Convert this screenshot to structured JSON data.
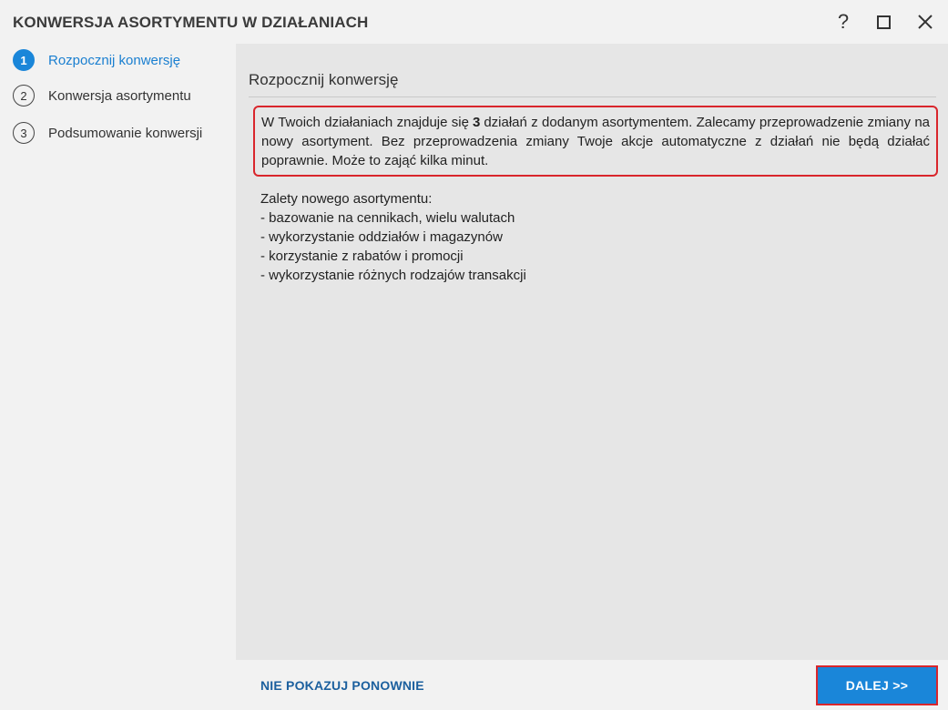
{
  "window": {
    "title": "KONWERSJA ASORTYMENTU W DZIAŁANIACH",
    "help_label": "?"
  },
  "steps": [
    {
      "number": "1",
      "label": "Rozpocznij konwersję",
      "active": true
    },
    {
      "number": "2",
      "label": "Konwersja asortymentu",
      "active": false
    },
    {
      "number": "3",
      "label": "Podsumowanie konwersji",
      "active": false
    }
  ],
  "main": {
    "section_title": "Rozpocznij konwersję",
    "notice": {
      "before": "W Twoich działaniach znajduje się",
      "count": "3",
      "after": "działań z dodanym asortymentem. Zalecamy przeprowadzenie zmiany na nowy asortyment. Bez przeprowadzenia zmiany Twoje akcje automatyczne z działań nie będą działać poprawnie. Może to zająć kilka minut."
    },
    "benefits_title": "Zalety nowego asortymentu:",
    "benefits": [
      "bazowanie na cennikach, wielu walutach",
      "wykorzystanie oddziałów i magazynów",
      "korzystanie z rabatów i promocji",
      "wykorzystanie różnych rodzajów transakcji"
    ]
  },
  "footer": {
    "dont_show_label": "NIE POKAZUJ PONOWNIE",
    "next_label": "DALEJ >>"
  },
  "colors": {
    "accent": "#1a86d9",
    "highlight_border": "#d9262c",
    "link": "#1b5f9e"
  }
}
